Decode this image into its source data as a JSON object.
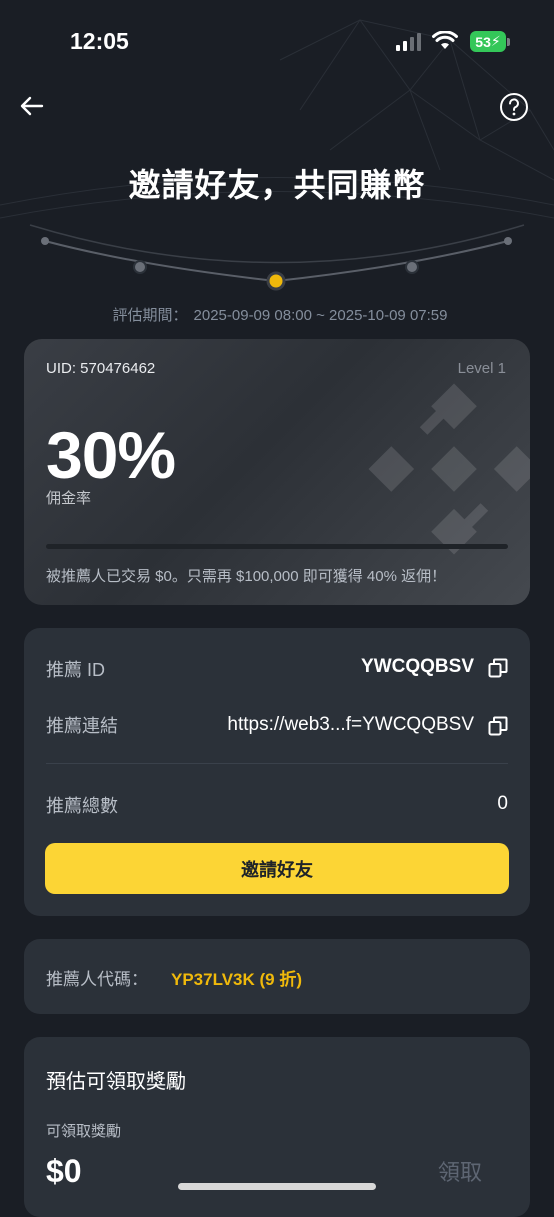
{
  "status_bar": {
    "time": "12:05",
    "battery": "53"
  },
  "header": {
    "title": "邀請好友，共同賺幣"
  },
  "period": {
    "label": "評估期間：",
    "range": "2025-09-09 08:00 ~ 2025-10-09 07:59"
  },
  "commission_card": {
    "uid": "UID: 570476462",
    "level": "Level 1",
    "rate": "30%",
    "rate_label": "佣金率",
    "progress": 0,
    "note": "被推薦人已交易 $0。只需再 $100,000 即可獲得 40% 返佣！"
  },
  "referral": {
    "id_label": "推薦 ID",
    "id_value": "YWCQQBSV",
    "link_label": "推薦連結",
    "link_value": "https://web3...f=YWCQQBSV",
    "total_label": "推薦總數",
    "total_value": "0",
    "invite_button": "邀請好友"
  },
  "referrer": {
    "label": "推薦人代碼：",
    "value": "YP37LV3K (9 折)"
  },
  "rewards": {
    "title": "預估可領取獎勵",
    "subtitle": "可領取獎勵",
    "amount": "$0",
    "claim_button": "領取"
  },
  "colors": {
    "accent": "#fcd535",
    "background": "#1a1e25",
    "card": "#2b3139",
    "highlight": "#f0b90b"
  },
  "icons": [
    "back-arrow-icon",
    "help-icon",
    "copy-icon",
    "binance-logo-icon"
  ]
}
